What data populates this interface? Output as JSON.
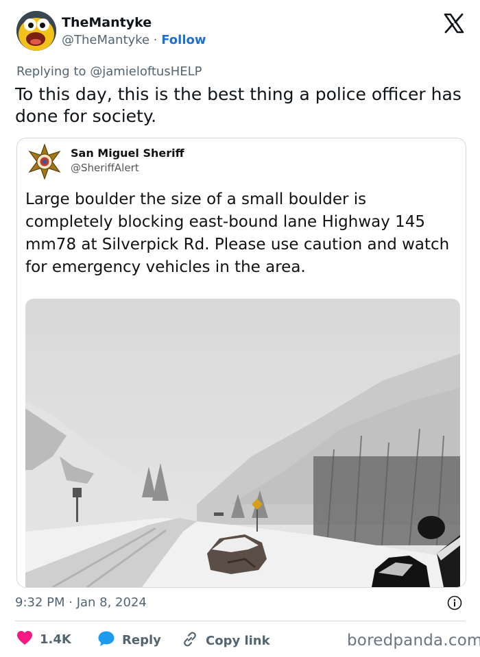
{
  "author": {
    "name": "TheMantyke",
    "handle": "@TheMantyke",
    "separator": "·",
    "follow_label": "Follow"
  },
  "reply_to": "Replying to @jamieloftusHELP",
  "tweet_text": "To this day, this is the best thing a police officer has done for society.",
  "quoted": {
    "name": "San Miguel Sheriff",
    "handle": "@SheriffAlert",
    "text": "Large boulder the size of a small boulder is completely blocking east-bound lane Highway 145 mm78 at Silverpick Rd. Please use caution and watch for emergency vehicles in the area."
  },
  "timestamp": "9:32 PM · Jan 8, 2024",
  "actions": {
    "likes": "1.4K",
    "reply_label": "Reply",
    "copy_label": "Copy link"
  },
  "watermark": "boredpanda.com",
  "icons": [
    "x-logo-icon",
    "sheriff-star-icon",
    "info-icon",
    "heart-icon",
    "reply-bubble-icon",
    "link-icon"
  ],
  "colors": {
    "follow": "#1d6fd6",
    "heart": "#f91880",
    "reply_bubble": "#1d9bf0",
    "muted": "#536471"
  }
}
